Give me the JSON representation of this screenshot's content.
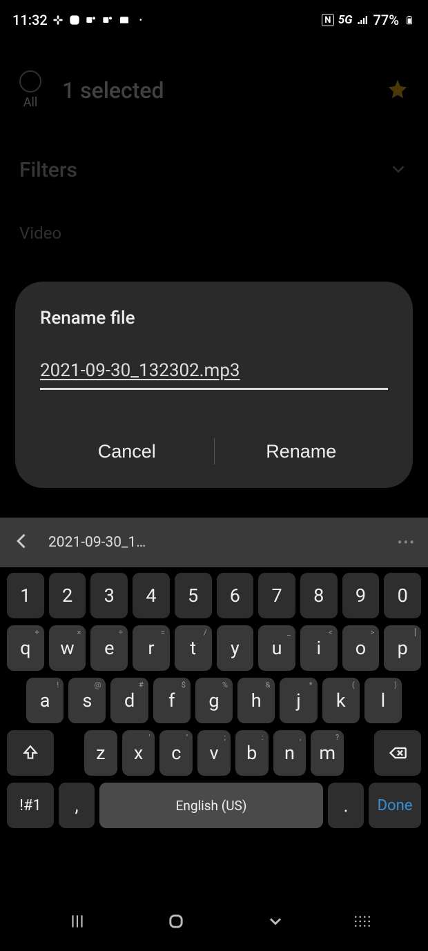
{
  "statusbar": {
    "time": "11:32",
    "nfc": "N",
    "network": "5G",
    "battery": "77%"
  },
  "header": {
    "all_label": "All",
    "selected": "1 selected"
  },
  "filters": {
    "label": "Filters"
  },
  "section": {
    "video": "Video"
  },
  "dialog": {
    "title": "Rename file",
    "filename": "2021-09-30_132302.mp3",
    "cancel": "Cancel",
    "rename": "Rename"
  },
  "suggest": {
    "text": "2021-09-30_1…",
    "more": "•••"
  },
  "keyboard": {
    "row1": [
      "1",
      "2",
      "3",
      "4",
      "5",
      "6",
      "7",
      "8",
      "9",
      "0"
    ],
    "row2": [
      {
        "k": "q",
        "s": "+"
      },
      {
        "k": "w",
        "s": "×"
      },
      {
        "k": "e",
        "s": "÷"
      },
      {
        "k": "r",
        "s": "="
      },
      {
        "k": "t",
        "s": "/"
      },
      {
        "k": "y",
        "s": ""
      },
      {
        "k": "u",
        "s": "_"
      },
      {
        "k": "i",
        "s": "<"
      },
      {
        "k": "o",
        "s": ">"
      },
      {
        "k": "p",
        "s": "["
      }
    ],
    "row2_extra": "]",
    "row3": [
      {
        "k": "a",
        "s": "!"
      },
      {
        "k": "s",
        "s": "@"
      },
      {
        "k": "d",
        "s": "#"
      },
      {
        "k": "f",
        "s": "$"
      },
      {
        "k": "g",
        "s": "%"
      },
      {
        "k": "h",
        "s": "&"
      },
      {
        "k": "j",
        "s": "*"
      },
      {
        "k": "k",
        "s": "("
      },
      {
        "k": "l",
        "s": ")"
      }
    ],
    "row4": [
      {
        "k": "z",
        "s": ""
      },
      {
        "k": "x",
        "s": "'"
      },
      {
        "k": "c",
        "s": "\""
      },
      {
        "k": "v",
        "s": ";"
      },
      {
        "k": "b",
        "s": ":"
      },
      {
        "k": "n",
        "s": ","
      },
      {
        "k": "m",
        "s": "?"
      }
    ],
    "sym": "!#1",
    "comma": ",",
    "space": "English (US)",
    "period": ".",
    "done": "Done"
  }
}
